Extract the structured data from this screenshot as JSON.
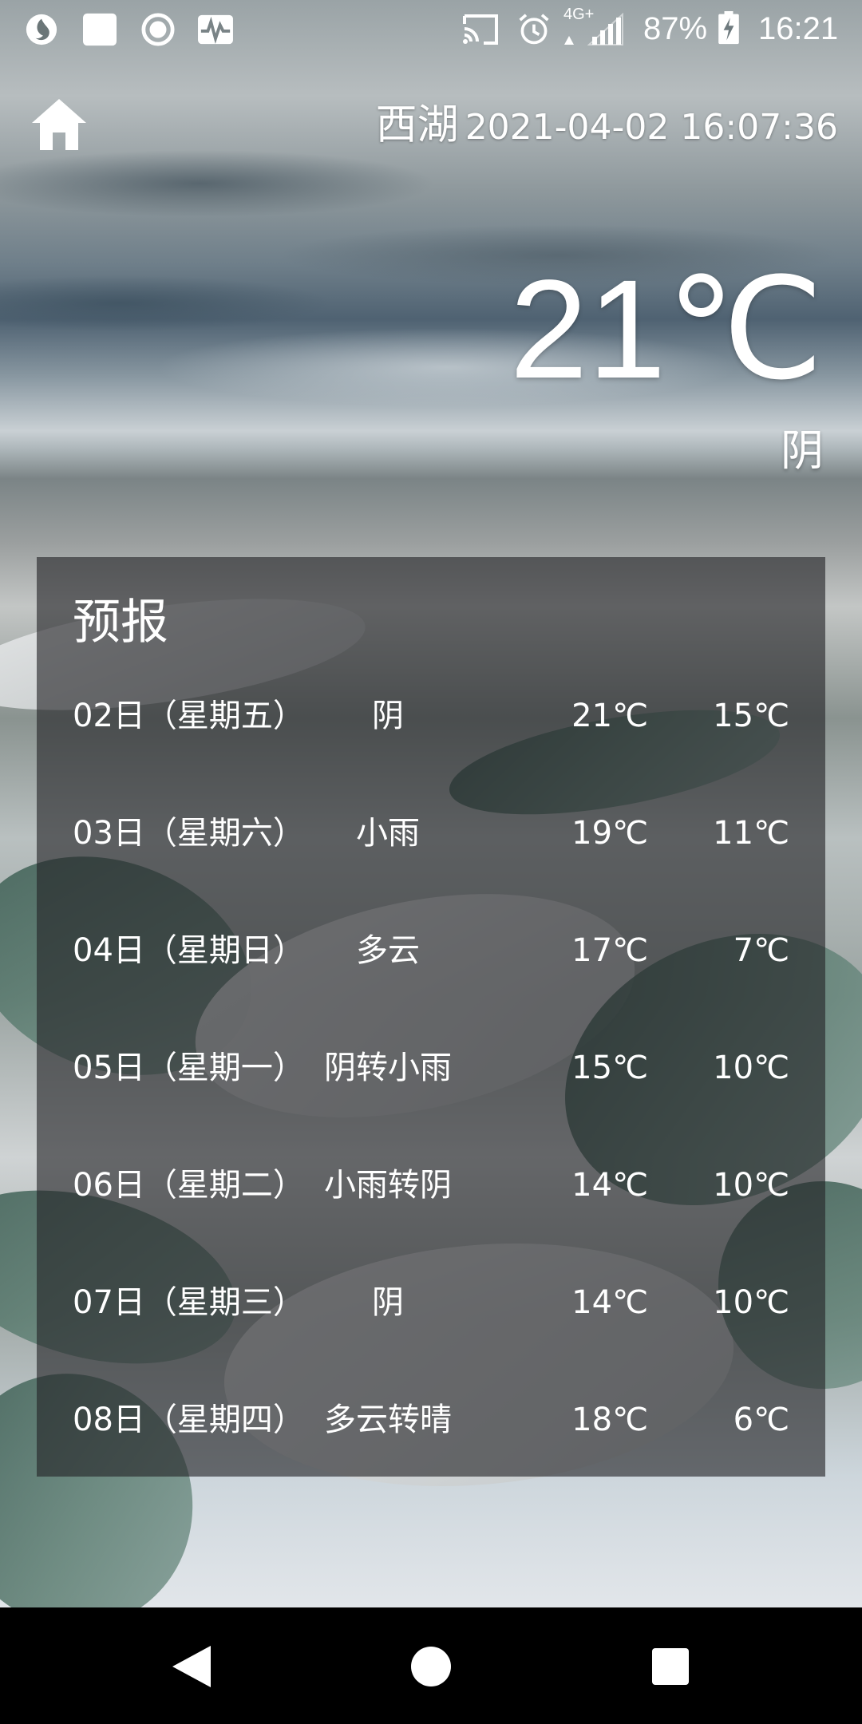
{
  "status_bar": {
    "battery": "87%",
    "time": "16:21",
    "network": "4G+",
    "icons": [
      "app-icon",
      "notification-square-icon",
      "circle-indicator-icon",
      "activity-icon",
      "cast-icon",
      "alarm-icon",
      "signal-icon",
      "battery-charging-icon"
    ]
  },
  "header": {
    "home_icon": "home-icon",
    "city": "西湖",
    "datetime": "2021-04-02 16:07:36"
  },
  "current": {
    "temperature": "21℃",
    "condition": "阴"
  },
  "forecast": {
    "title": "预报",
    "rows": [
      {
        "date": "02日（星期五）",
        "weather": "阴",
        "high": "21℃",
        "low": "15℃"
      },
      {
        "date": "03日（星期六）",
        "weather": "小雨",
        "high": "19℃",
        "low": "11℃"
      },
      {
        "date": "04日（星期日）",
        "weather": "多云",
        "high": "17℃",
        "low": "7℃"
      },
      {
        "date": "05日（星期一）",
        "weather": "阴转小雨",
        "high": "15℃",
        "low": "10℃"
      },
      {
        "date": "06日（星期二）",
        "weather": "小雨转阴",
        "high": "14℃",
        "low": "10℃"
      },
      {
        "date": "07日（星期三）",
        "weather": "阴",
        "high": "14℃",
        "low": "10℃"
      },
      {
        "date": "08日（星期四）",
        "weather": "多云转晴",
        "high": "18℃",
        "low": "6℃"
      }
    ]
  },
  "nav_bar": {
    "icons": [
      "back-icon",
      "home-circle-icon",
      "recents-icon"
    ]
  }
}
